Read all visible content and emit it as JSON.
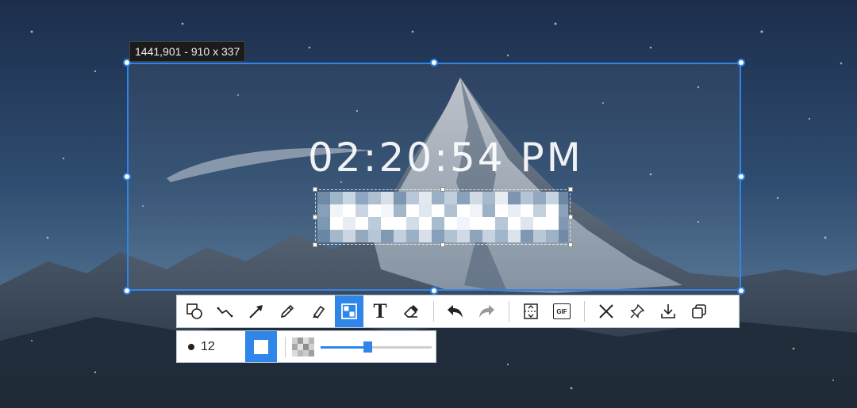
{
  "capture": {
    "size_label": "1441,901 - 910 x 337",
    "clock_text": "02:20:54 PM"
  },
  "toolbar": {
    "tools": [
      {
        "name": "shape-tool",
        "icon": "shape-icon",
        "active": false
      },
      {
        "name": "polyline-tool",
        "icon": "polyline-icon",
        "active": false
      },
      {
        "name": "arrow-tool",
        "icon": "arrow-icon",
        "active": false
      },
      {
        "name": "pencil-tool",
        "icon": "pencil-icon",
        "active": false
      },
      {
        "name": "highlighter-tool",
        "icon": "highlighter-icon",
        "active": false
      },
      {
        "name": "mosaic-tool",
        "icon": "mosaic-icon",
        "active": true
      },
      {
        "name": "text-tool",
        "icon": "text-icon",
        "active": false
      },
      {
        "name": "eraser-tool",
        "icon": "eraser-icon",
        "active": false
      },
      {
        "name": "undo-button",
        "icon": "undo-icon",
        "active": false
      },
      {
        "name": "redo-button",
        "icon": "redo-icon",
        "active": false
      },
      {
        "name": "scroll-capture-button",
        "icon": "scroll-capture-icon",
        "active": false
      },
      {
        "name": "gif-button",
        "icon": "gif-icon",
        "active": false
      },
      {
        "name": "close-button",
        "icon": "close-icon",
        "active": false
      },
      {
        "name": "pin-button",
        "icon": "pin-icon",
        "active": false
      },
      {
        "name": "save-button",
        "icon": "download-icon",
        "active": false
      },
      {
        "name": "copy-button",
        "icon": "copy-icon",
        "active": false
      }
    ],
    "text_glyph": "T",
    "gif_glyph": "GIF"
  },
  "subbar": {
    "brush_size": "12",
    "mosaic_strength": 0.42
  },
  "colors": {
    "accent": "#2f86e8"
  }
}
